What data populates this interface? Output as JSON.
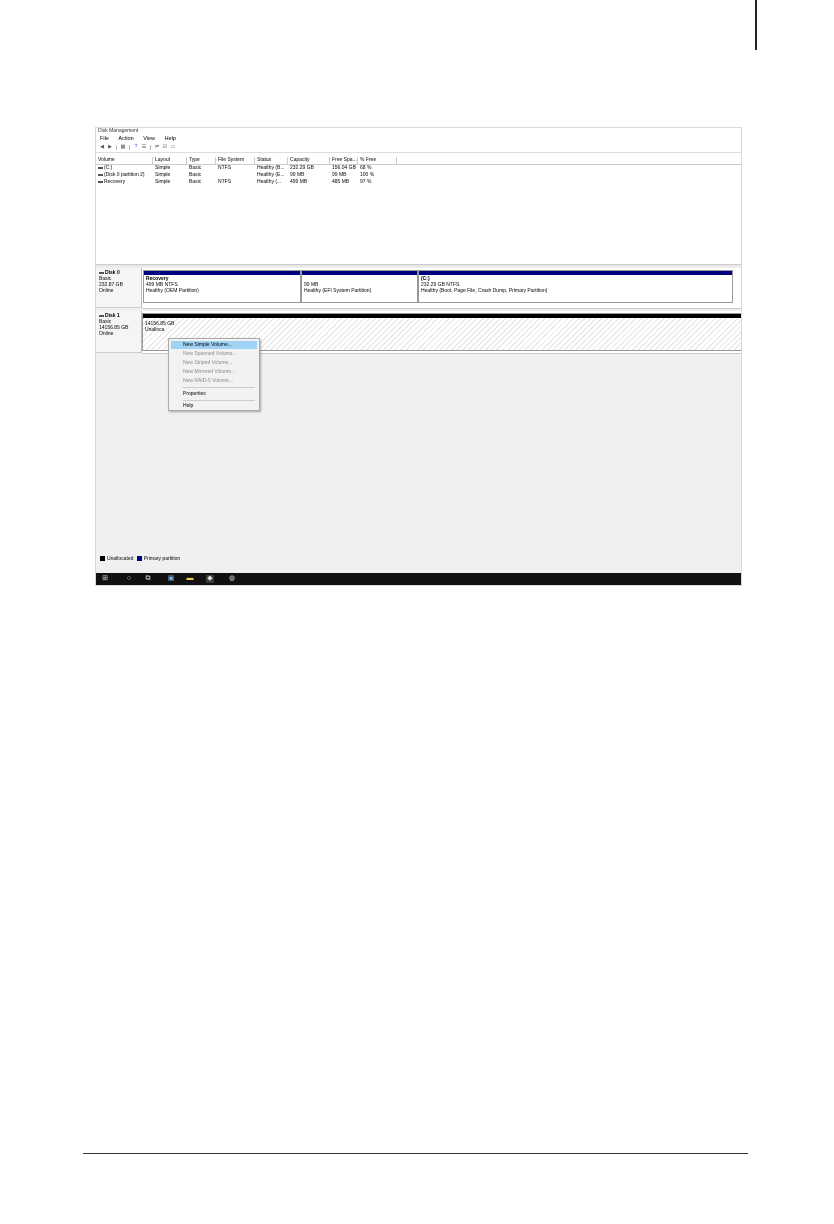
{
  "window": {
    "title": "Disk Management"
  },
  "menu": [
    "File",
    "Action",
    "View",
    "Help"
  ],
  "toolbar_icons": [
    "back-arrow-icon",
    "forward-arrow-icon",
    "grid-icon",
    "help-icon",
    "list-icon",
    "connect-icon",
    "check-icon",
    "window-icon"
  ],
  "volume_table": {
    "headers": [
      "Volume",
      "Layout",
      "Type",
      "File System",
      "Status",
      "Capacity",
      "Free Spa...",
      "% Free"
    ],
    "rows": [
      [
        "(C:)",
        "Simple",
        "Basic",
        "NTFS",
        "Healthy (B...",
        "232.29 GB",
        "156.04 GB",
        "68 %"
      ],
      [
        "(Disk 0 partition 2)",
        "Simple",
        "Basic",
        "",
        "Healthy (E...",
        "99 MB",
        "99 MB",
        "100 %"
      ],
      [
        "Recovery",
        "Simple",
        "Basic",
        "NTFS",
        "Healthy (...",
        "499 MB",
        "485 MB",
        "97 %"
      ]
    ]
  },
  "disk0": {
    "name": "Disk 0",
    "type": "Basic",
    "size": "232.87 GB",
    "status": "Online",
    "partitions": [
      {
        "title": "Recovery",
        "size": "499 MB NTFS",
        "status": "Healthy (OEM Partition)"
      },
      {
        "title": "",
        "size": "99 MB",
        "status": "Healthy (EFI System Partition)"
      },
      {
        "title": "(C:)",
        "size": "232.29 GB NTFS",
        "status": "Healthy (Boot, Page File, Crash Dump, Primary Partition)"
      }
    ]
  },
  "disk1": {
    "name": "Disk 1",
    "type": "Basic",
    "size": "14156.85 GB",
    "status": "Online",
    "unallocated_size": "14156.85 GB",
    "unallocated_label": "Unalloca"
  },
  "context_menu": {
    "items": [
      "New Simple Volume...",
      "New Spanned Volume...",
      "New Striped Volume...",
      "New Mirrored Volume...",
      "New RAID-5 Volume...",
      "Properties",
      "Help"
    ]
  },
  "legend": {
    "unallocated": "Unallocated",
    "primary": "Primary partition"
  },
  "colors": {
    "primary": "#00007f",
    "unallocated": "#000000",
    "highlight": "#9fd3f5",
    "taskbar": "#111111"
  }
}
